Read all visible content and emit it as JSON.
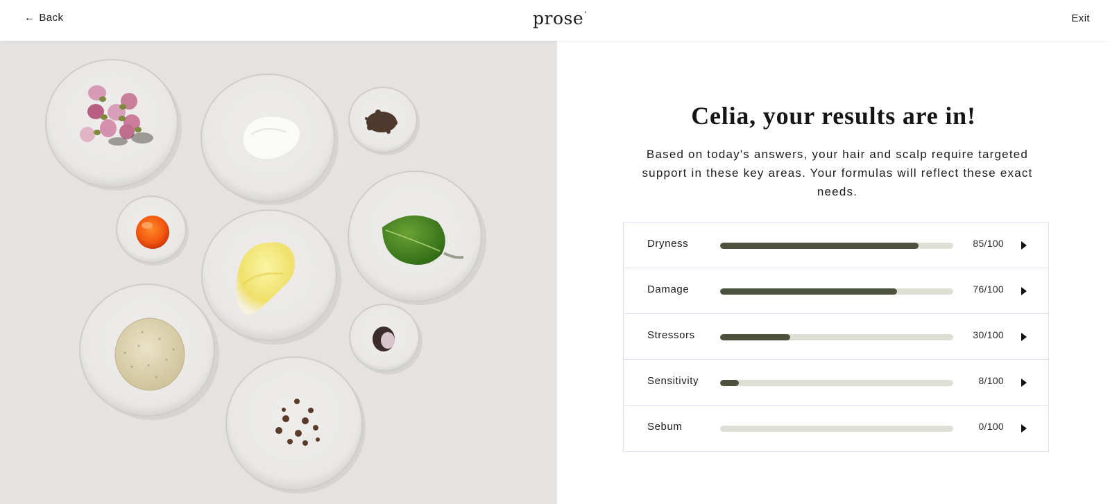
{
  "header": {
    "back_arrow": "←",
    "back_label": "Back",
    "logo": "prose",
    "logo_mark": "°",
    "exit_label": "Exit"
  },
  "main": {
    "headline": "Celia, your results are in!",
    "description": "Based on today's answers, your hair and scalp require targeted support in these key areas. Your formulas will reflect these exact needs."
  },
  "results": [
    {
      "label": "Dryness",
      "score": "85/100",
      "value": 85
    },
    {
      "label": "Damage",
      "score": "76/100",
      "value": 76
    },
    {
      "label": "Stressors",
      "score": "30/100",
      "value": 30
    },
    {
      "label": "Sensitivity",
      "score": "8/100",
      "value": 8
    },
    {
      "label": "Sebum",
      "score": "0/100",
      "value": 0
    }
  ],
  "colors": {
    "bar_fill": "#4b513c",
    "bar_track": "#dedfd4",
    "panel_bg": "#e4e3e1",
    "row_border": "#e4dff0"
  },
  "icons": {
    "back": "left-arrow-icon",
    "expand": "caret-right-icon"
  }
}
